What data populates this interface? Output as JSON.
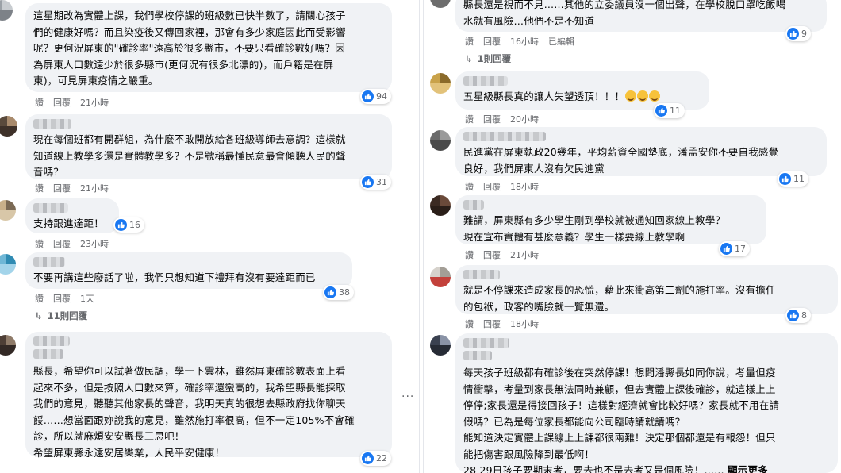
{
  "colors": {
    "bubble": "#f0f2f5",
    "like_blue": "#1877f2",
    "meta_gray": "#65676b",
    "text": "#050505"
  },
  "icons": {
    "like": "like-thumb-icon",
    "reply_arrow": "reply-arrow-icon",
    "more": "more-options-icon"
  },
  "left_comments": [
    {
      "text": "這星期改為實體上課，我們學校停課的班級數已快半數了，請關心孩子\n們的健康好嗎？而且染疫後又傳回家裡，那會有多少家庭因此而受影響\n呢？更何況屏東的\"確診率\"遠高於很多縣市，不要只看確診數好嗎？因\n為屏東人口數遠少於很多縣市(更何況有很多北漂的)，而戶籍是在屏\n東)，可見屏東疫情之嚴重。",
      "like": "讚",
      "reply": "回覆",
      "time": "21小時",
      "reactions": "94"
    },
    {
      "text": "現在每個班都有開群組，為什麼不敢開放給各班級導師去意調？這樣就\n知道線上教學多還是實體教學多？不是號稱最懂民意最會傾聽人民的聲\n音嗎？",
      "like": "讚",
      "reply": "回覆",
      "time": "21小時",
      "reactions": "31"
    },
    {
      "text": "支持跟進達距！",
      "like": "讚",
      "reply": "回覆",
      "time": "23小時",
      "reactions": "16"
    },
    {
      "text": "不要再講這些廢話了啦，我們只想知道下禮拜有沒有要達距而已",
      "like": "讚",
      "reply": "回覆",
      "time": "1天",
      "reactions": "38",
      "replies": "11則回覆"
    },
    {
      "text": "縣長，希望你可以試著做民調，學一下雲林，雖然屏東確診數表面上看\n起來不多，但是按照人口數來算，確診率還蠻高的，我希望縣長能採取\n我們的意見，聽聽其他家長的聲音，我明天真的很想去縣政府找你聊天\n餒……想當面跟妳說我的意見，雖然施打率很高，但不一定105%不會確\n診，所以就麻煩安安縣長三思吧！\n希望屏東縣永遠安居樂業，人民平安健康！",
      "reactions": "22"
    }
  ],
  "right_comments": [
    {
      "text": "縣長還是視而不見……其他的立委議員沒一個出聲，在學校脫口罩吃飯喝\n水就有風險…他們不是不知道",
      "like": "讚",
      "reply": "回覆",
      "time": "16小時",
      "edited": "已編輯",
      "reactions": "9",
      "replies": "1則回覆"
    },
    {
      "text": "五星級縣長真的讓人失望透頂！！！",
      "like": "讚",
      "reply": "回覆",
      "time": "20小時",
      "reactions": "11"
    },
    {
      "text": "民進黨在屏東執政20幾年，平均薪資全國墊底，潘孟安你不要自我感覺\n良好，我們屏東人沒有欠民進黨",
      "like": "讚",
      "reply": "回覆",
      "time": "18小時",
      "reactions": "11"
    },
    {
      "text": "難謂，屏東縣有多少學生剛到學校就被通知回家線上教學？\n現在宣布實體有甚麼意義？學生一樣要線上教學啊",
      "like": "讚",
      "reply": "回覆",
      "time": "21小時",
      "reactions": "17"
    },
    {
      "text": "就是不停課來造成家長的恐慌，藉此來衝高第二劑的施打率。沒有擔任\n的包袱，政客的嘴臉就一覽無遺。",
      "like": "讚",
      "reply": "回覆",
      "time": "18小時",
      "reactions": "8"
    },
    {
      "text": "每天孩子班級都有確診後在突然停課！想問潘縣長如同你說，考量但疫\n情衝擊，考量到家長無法同時兼顧，但去實體上課後確診，就這樣上上\n停停;家長還是得接回孩子！這樣對經濟就會比較好嗎？家長就不用在請\n假嗎？已為是每位家長都能向公司臨時請就請嗎？\n能知道決定實體上課線上上課都很兩難！決定那個都還是有報怨！但只\n能把傷害跟風險降到最低啊！\n28 29日孩子要期末考，要去也不是去考又是個風險！……",
      "see_more": "顯示更多"
    }
  ]
}
